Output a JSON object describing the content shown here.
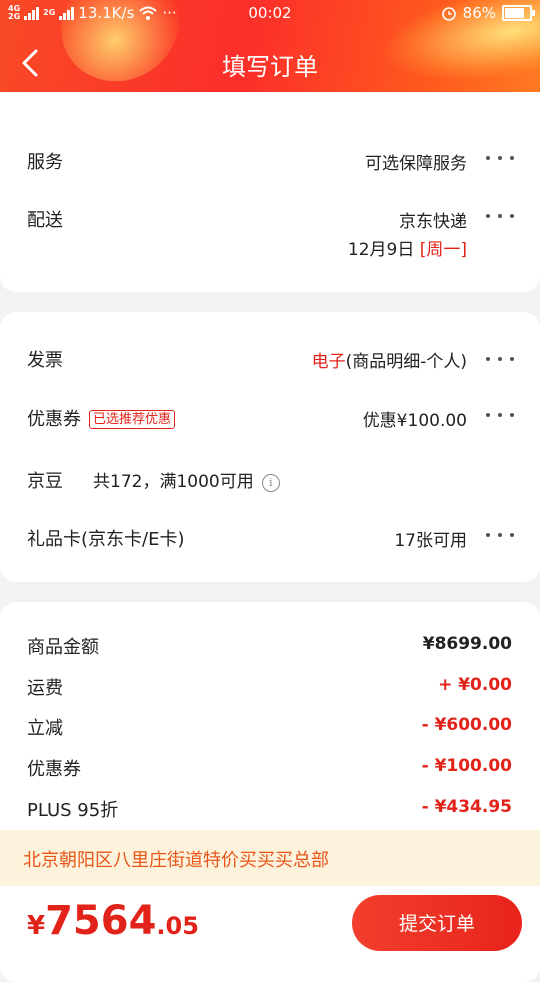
{
  "status_bar": {
    "net_top": "4G",
    "net_bottom": "2G",
    "net2_top": "2G",
    "speed": "13.1K/s",
    "more": "···",
    "time": "00:02",
    "battery": "86%",
    "battery_level": 0.86,
    "icons": [
      "signal-icon",
      "wifi-icon",
      "alarm-icon",
      "battery-icon"
    ]
  },
  "header": {
    "title": "填写订单",
    "back_icon": "chevron-left-icon",
    "color": "#fb2e2a"
  },
  "delivery_card": {
    "service": {
      "label": "服务",
      "value": "可选保障服务"
    },
    "shipping": {
      "label": "配送",
      "value": "京东快递",
      "date": "12月9日",
      "weekday": "[周一]"
    }
  },
  "invoice_card": {
    "invoice": {
      "label": "发票",
      "value_red": "电子",
      "value_rest": "(商品明细-个人)"
    },
    "coupon": {
      "label": "优惠券",
      "tag": "已选推荐优惠",
      "value": "优惠¥100.00"
    },
    "beans": {
      "label": "京豆",
      "info": "共172，满1000可用",
      "info_icon": "i"
    },
    "giftcard": {
      "label": "礼品卡(京东卡/E卡)",
      "value": "17张可用"
    }
  },
  "summary": {
    "goods": {
      "label": "商品金额",
      "value": "¥8699.00"
    },
    "freight": {
      "label": "运费",
      "value": "+ ¥0.00"
    },
    "discount": {
      "label": "立减",
      "value": "- ¥600.00"
    },
    "coupon": {
      "label": "优惠券",
      "value": "- ¥100.00"
    },
    "plus": {
      "label": "PLUS 95折",
      "value": "- ¥434.95"
    }
  },
  "notice": {
    "text": "北京朝阳区八里庄街道特价买买买总部"
  },
  "footer": {
    "currency": "¥",
    "total_int": "7564",
    "total_dec": ".05",
    "submit_label": "提交订单",
    "accent": "#e2231a"
  }
}
